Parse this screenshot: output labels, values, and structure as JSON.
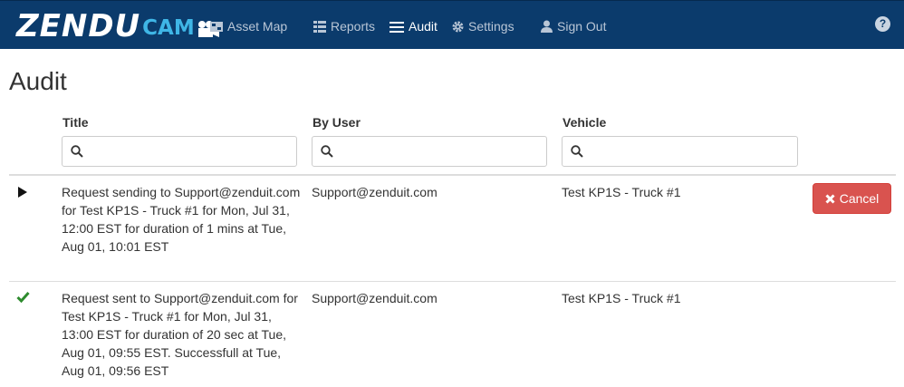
{
  "brand": {
    "logo_main": "ZENDU",
    "logo_sub": "CAM"
  },
  "nav": {
    "asset_map": "Asset Map",
    "reports": "Reports",
    "audit": "Audit",
    "settings": "Settings",
    "sign_out": "Sign Out",
    "help": "?"
  },
  "page": {
    "title": "Audit"
  },
  "table": {
    "columns": {
      "title": "Title",
      "by_user": "By User",
      "vehicle": "Vehicle"
    },
    "filters": {
      "title_value": "",
      "by_user_value": "",
      "vehicle_value": ""
    },
    "rows": [
      {
        "status_icon": "play-icon",
        "title": "Request sending to Support@zenduit.com for Test KP1S - Truck #1 for Mon, Jul 31, 12:00 EST for duration of 1 mins at Tue, Aug 01, 10:01 EST",
        "by_user": "Support@zenduit.com",
        "vehicle": "Test KP1S - Truck #1",
        "action": "Cancel"
      },
      {
        "status_icon": "check-icon",
        "title": "Request sent to Support@zenduit.com for Test KP1S - Truck #1 for Mon, Jul 31, 13:00 EST for duration of 20 sec at Tue, Aug 01, 09:55 EST. Successfull at Tue, Aug 01, 09:56 EST",
        "by_user": "Support@zenduit.com",
        "vehicle": "Test KP1S - Truck #1"
      }
    ]
  },
  "colors": {
    "navbar": "#0b3b6c",
    "cancel": "#d9534f",
    "success": "#2e8b2e"
  }
}
